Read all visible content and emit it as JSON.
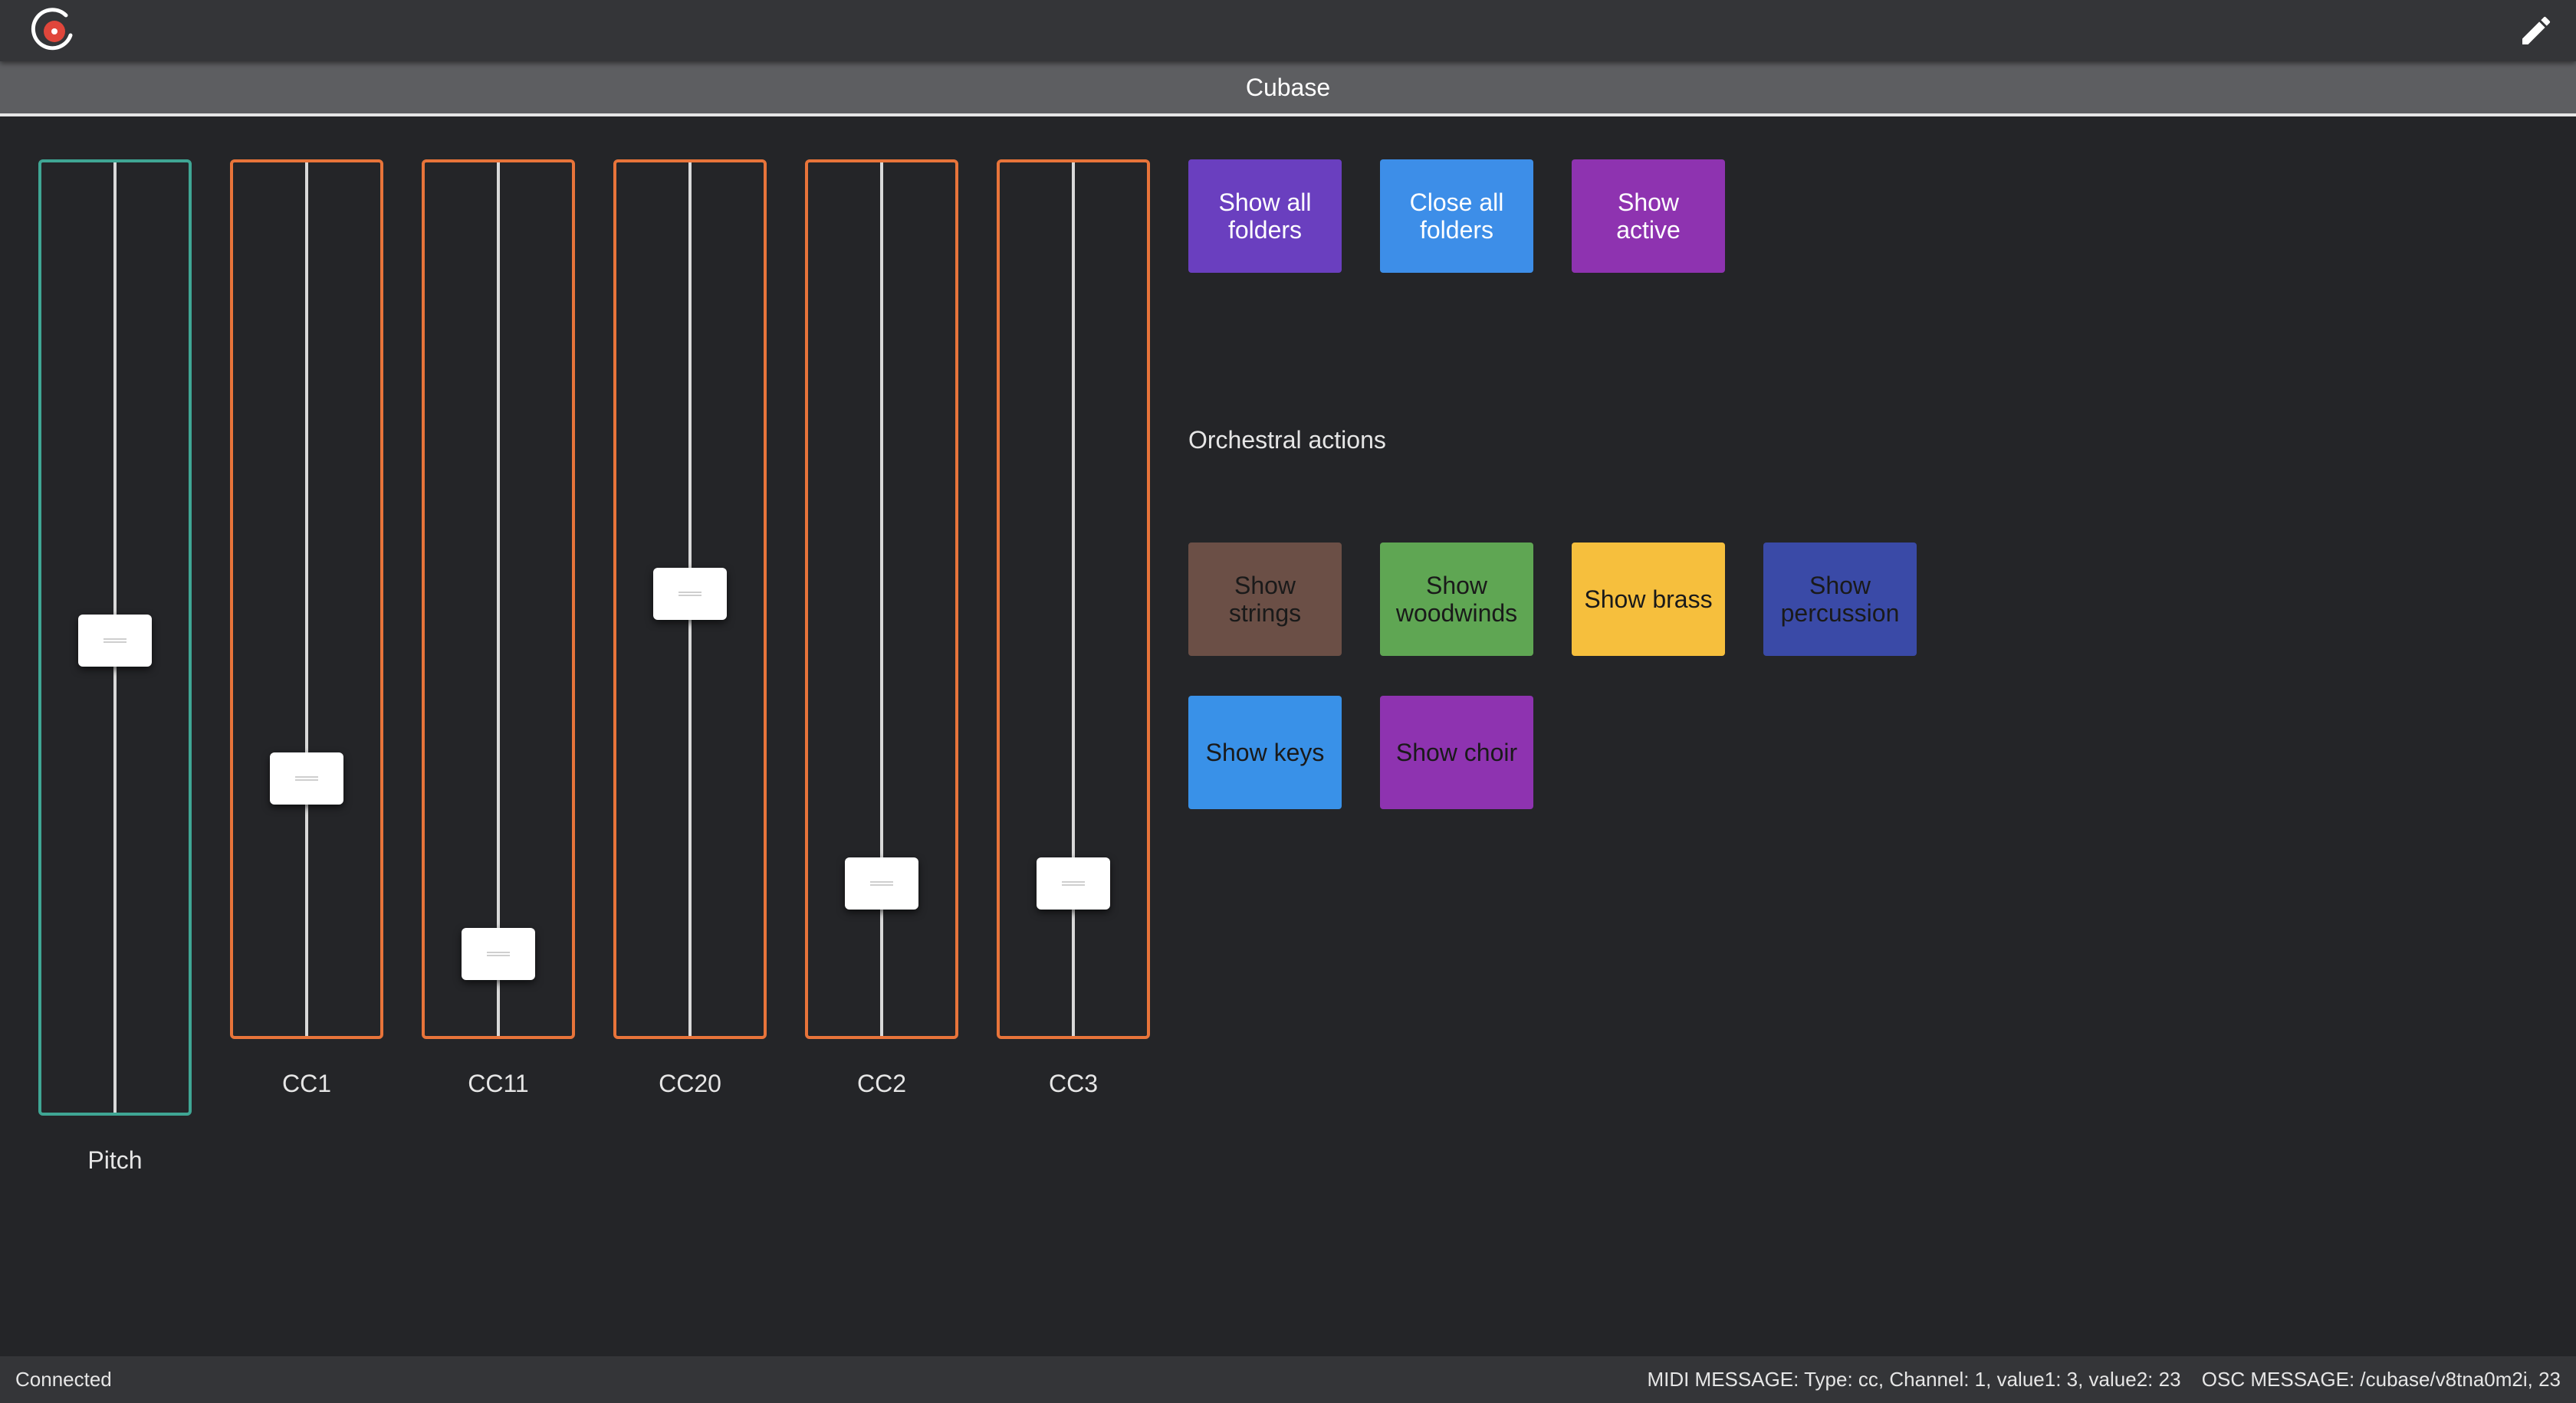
{
  "header": {
    "logo_icon": "open-stage-control-logo",
    "edit_icon": "pencil-icon",
    "title": "Cubase"
  },
  "faders": [
    {
      "label": "Pitch",
      "value": 0.5,
      "color": "#3fa694"
    },
    {
      "label": "CC1",
      "value": 0.3,
      "color": "#e8743a"
    },
    {
      "label": "CC11",
      "value": 0.1,
      "color": "#e8743a"
    },
    {
      "label": "CC20",
      "value": 0.51,
      "color": "#e8743a"
    },
    {
      "label": "CC2",
      "value": 0.18,
      "color": "#e8743a"
    },
    {
      "label": "CC3",
      "value": 0.18,
      "color": "#e8743a"
    }
  ],
  "folder_buttons": [
    {
      "label": "Show all folders",
      "color": "#6a3fbf",
      "text_color": "#ffffff"
    },
    {
      "label": "Close all folders",
      "color": "#3d8ee8",
      "text_color": "#ffffff"
    },
    {
      "label": "Show active",
      "color": "#8e33b0",
      "text_color": "#ffffff"
    }
  ],
  "orchestral_section_label": "Orchestral actions",
  "orchestral_buttons": [
    {
      "label": "Show strings",
      "color": "#6b4f46",
      "text_color": "#1a1a1a"
    },
    {
      "label": "Show woodwinds",
      "color": "#5fa653",
      "text_color": "#1a1a1a"
    },
    {
      "label": "Show brass",
      "color": "#f6bf3d",
      "text_color": "#1a1a1a"
    },
    {
      "label": "Show percussion",
      "color": "#3a4aa7",
      "text_color": "#1a1a1a"
    },
    {
      "label": "Show keys",
      "color": "#3991e8",
      "text_color": "#1a1a1a"
    },
    {
      "label": "Show choir",
      "color": "#8e33b0",
      "text_color": "#1a1a1a"
    }
  ],
  "status": {
    "connection": "Connected",
    "midi_message": "MIDI MESSAGE:  Type: cc, Channel: 1, value1: 3, value2: 23",
    "osc_message": "OSC MESSAGE:  /cubase/v8tna0m2i, 23"
  }
}
